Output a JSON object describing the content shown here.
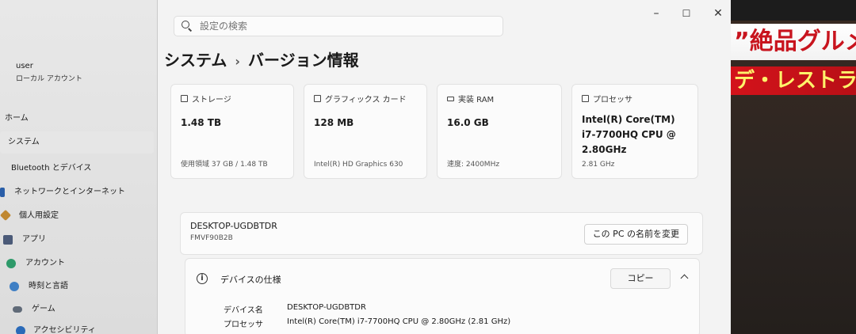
{
  "window": {
    "search_placeholder": "設定の検索",
    "min_glyph": "–",
    "max_glyph": "☐",
    "close_glyph": "✕"
  },
  "breadcrumb": {
    "parent": "システム",
    "separator": "›",
    "current": "バージョン情報"
  },
  "user": {
    "name": "user",
    "account_type": "ローカル アカウント"
  },
  "sidebar": {
    "items": [
      {
        "label": "ホーム",
        "icon": "home-icon"
      },
      {
        "label": "システム",
        "icon": "system-icon",
        "active": true
      },
      {
        "label": "Bluetooth とデバイス",
        "icon": "bluetooth-icon"
      },
      {
        "label": "ネットワークとインターネット",
        "icon": "network-icon"
      },
      {
        "label": "個人用設定",
        "icon": "brush-icon"
      },
      {
        "label": "アプリ",
        "icon": "apps-icon"
      },
      {
        "label": "アカウント",
        "icon": "account-icon"
      },
      {
        "label": "時刻と言語",
        "icon": "clock-icon"
      },
      {
        "label": "ゲーム",
        "icon": "gamepad-icon"
      },
      {
        "label": "アクセシビリティ",
        "icon": "accessibility-icon"
      }
    ]
  },
  "cards": [
    {
      "title": "ストレージ",
      "value": "1.48 TB",
      "sub": "使用領域 37 GB / 1.48 TB",
      "icon": "storage-icon"
    },
    {
      "title": "グラフィックス カード",
      "value": "128 MB",
      "sub": "Intel(R) HD Graphics 630",
      "icon": "graphics-card-icon"
    },
    {
      "title": "実装 RAM",
      "value": "16.0 GB",
      "sub": "速度: 2400MHz",
      "icon": "ram-icon"
    },
    {
      "title": "プロセッサ",
      "value": "Intel(R) Core(TM) i7-7700HQ CPU @ 2.80GHz",
      "sub": "2.81 GHz",
      "icon": "processor-icon"
    }
  ],
  "device": {
    "name": "DESKTOP-UGDBTDR",
    "model": "FMVF90B2B",
    "rename_label": "この PC の名前を変更"
  },
  "specs": {
    "title": "デバイスの仕様",
    "copy_label": "コピー",
    "rows": [
      {
        "label": "デバイス名",
        "value": "DESKTOP-UGDBTDR"
      },
      {
        "label": "プロセッサ",
        "value": "Intel(R) Core(TM) i7-7700HQ CPU @ 2.80GHz (2.81 GHz)"
      }
    ]
  },
  "background": {
    "tv_banner_top": "”絶品グルメ",
    "tv_banner_bottom": "デ・レストラン"
  },
  "colors": {
    "accent": "#0067c0",
    "active_nav": "#e6e6e6"
  }
}
